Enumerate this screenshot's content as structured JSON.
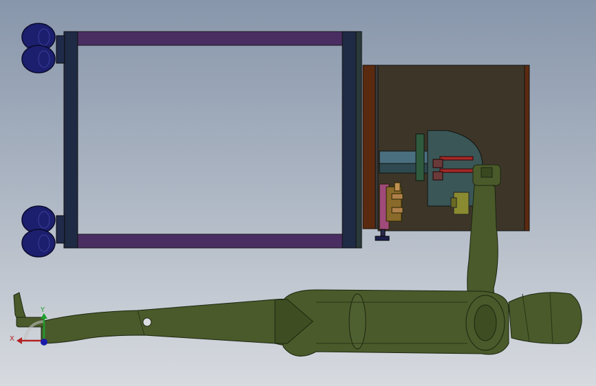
{
  "view": {
    "background_top": "#8896ab",
    "background_bottom": "#d7dadf"
  },
  "triad": {
    "x_label": "X",
    "y_label": "Y",
    "x_color": "#b22222",
    "y_color": "#1e9e2e",
    "z_color": "#1a1aa8"
  },
  "palette": {
    "frame_purple": "#4a2e62",
    "frame_navy": "#1f2a44",
    "caster_blue": "#1c1f6e",
    "plate_brown": "#3d3628",
    "robot_green": "#4a5a2a",
    "robot_outline": "#1c2410"
  }
}
